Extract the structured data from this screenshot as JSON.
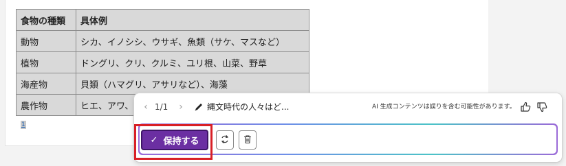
{
  "table": {
    "headers": [
      "食物の種類",
      "具体例"
    ],
    "rows": [
      [
        "動物",
        "シカ、イノシシ、ウサギ、魚類（サケ、マスなど）"
      ],
      [
        "植物",
        "ドングリ、クリ、クルミ、ユリ根、山菜、野草"
      ],
      [
        "海産物",
        "貝類（ハマグリ、アサリなど）、海藻"
      ],
      [
        "農作物",
        "ヒエ、アワ、"
      ]
    ]
  },
  "footnote": "1",
  "copilot": {
    "pager": "1/1",
    "prev_icon": "chevron-left-icon",
    "next_icon": "chevron-right-icon",
    "prompt_icon": "pencil-icon",
    "prompt_title": "縄文時代の人々はど...",
    "disclaimer": "AI 生成コンテンツは誤りを含む可能性があります。",
    "keep_label": "保持する",
    "regenerate_icon": "regenerate-icon",
    "delete_icon": "trash-icon",
    "highlight_color": "#d81f26",
    "accent_color": "#6b2fa2"
  }
}
